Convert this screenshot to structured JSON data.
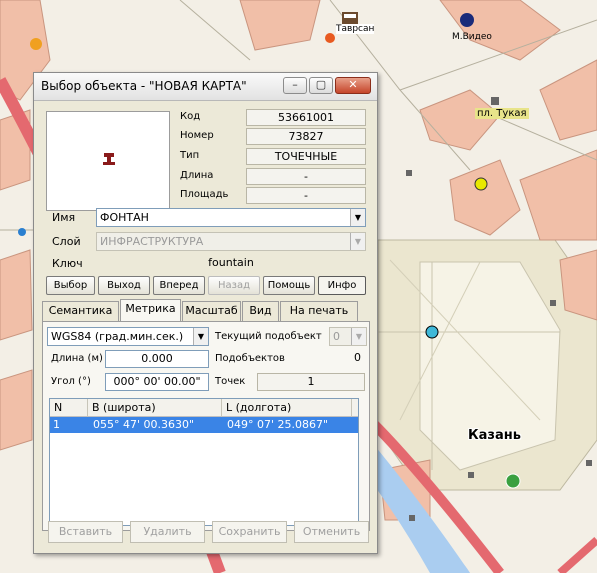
{
  "map": {
    "labels": {
      "hotel": "Таврсан",
      "store": "М.Видео",
      "square": "пл. Тукая",
      "city": "Казань"
    }
  },
  "window": {
    "title": "Выбор объекта - \"НОВАЯ КАРТА\"",
    "title_buttons": {
      "minimize": "–",
      "maximize": "▢",
      "close": "✕"
    }
  },
  "props": {
    "kod_label": "Код",
    "kod_value": "53661001",
    "nomer_label": "Номер",
    "nomer_value": "73827",
    "tip_label": "Тип",
    "tip_value": "ТОЧЕЧНЫЕ",
    "dlina_label": "Длина",
    "dlina_value": "-",
    "ploshad_label": "Площадь",
    "ploshad_value": "-"
  },
  "fields": {
    "imya_label": "Имя",
    "imya_value": "ФОНТАН",
    "sloy_label": "Слой",
    "sloy_value": "ИНФРАСТРУКТУРА",
    "klyuch_label": "Ключ",
    "klyuch_value": "fountain"
  },
  "buttons": {
    "vybor": "Выбор",
    "vyhod": "Выход",
    "vpered": "Вперед",
    "nazad": "Назад",
    "pomosh": "Помощь",
    "info": "Инфо"
  },
  "tabs": [
    "Семантика",
    "Метрика",
    "Масштаб",
    "Вид",
    "На печать"
  ],
  "metrika": {
    "system_value": "WGS84 (град.мин.сек.)",
    "current_sub_label": "Текущий подобъект",
    "current_sub_value": "0",
    "length_label": "Длина (м)",
    "length_value": "0.000",
    "subobjects_label": "Подобъектов",
    "subobjects_value": "0",
    "angle_label": "Угол (°)",
    "angle_value": "000° 00' 00.00\"",
    "points_label": "Точек",
    "points_value": "1",
    "grid_headers": [
      "N",
      "B  (широта)",
      "L  (долгота)"
    ],
    "grid_rows": [
      {
        "n": "1",
        "b": "055° 47' 00.3630\"",
        "l": "049° 07' 25.0867\""
      }
    ]
  },
  "bottom_buttons": {
    "vstavit": "Вставить",
    "udalit": "Удалить",
    "sohranit": "Сохранить",
    "otmenit": "Отменить"
  },
  "colors": {
    "selection": "#3a84e6",
    "road_red": "#e4696f",
    "building": "#f1bfa8",
    "water": "#aacdf0",
    "park": "#ebe6cf"
  }
}
